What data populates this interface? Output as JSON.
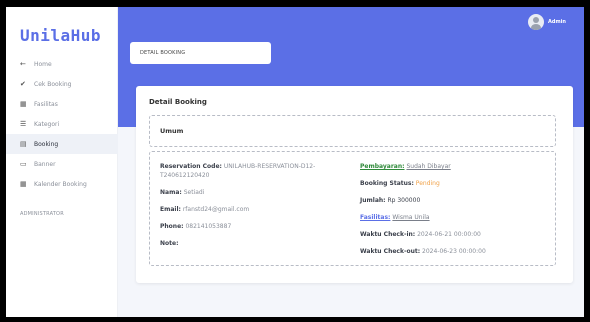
{
  "brand": "UnilaHub",
  "sidebar": {
    "items": [
      {
        "label": "Home",
        "icon": "arrow-left-icon",
        "glyph": "←",
        "active": false
      },
      {
        "label": "Cek Booking",
        "icon": "check-icon",
        "glyph": "✔",
        "active": false
      },
      {
        "label": "Fasilitas",
        "icon": "building-icon",
        "glyph": "▦",
        "active": false
      },
      {
        "label": "Kategori",
        "icon": "list-icon",
        "glyph": "☰",
        "active": false
      },
      {
        "label": "Booking",
        "icon": "book-icon",
        "glyph": "▤",
        "active": true
      },
      {
        "label": "Banner",
        "icon": "image-icon",
        "glyph": "▭",
        "active": false
      },
      {
        "label": "Kalender Booking",
        "icon": "calendar-icon",
        "glyph": "▦",
        "active": false
      }
    ],
    "section_label": "ADMINISTRATOR"
  },
  "header": {
    "user_label": "Admin",
    "breadcrumb": "DETAIL BOOKING",
    "accent_color": "#5b6fe6"
  },
  "card": {
    "title": "Detail Booking",
    "section_title": "Umum",
    "left": {
      "reservation_label": "Reservation Code:",
      "reservation_value": "UNILAHUB-RESERVATION-D12-T240612120420",
      "nama_label": "Nama:",
      "nama_value": "Setiadi",
      "email_label": "Email:",
      "email_value": "rfanstd24@gmail.com",
      "phone_label": "Phone:",
      "phone_value": "082141053887",
      "note_label": "Note:",
      "note_value": ""
    },
    "right": {
      "pembayaran_label": "Pembayaran:",
      "pembayaran_value": "Sudah Dibayar",
      "status_label": "Booking Status:",
      "status_value": "Pending",
      "jumlah_label": "Jumlah:",
      "jumlah_value": "Rp 300000",
      "fasilitas_label": "Fasilitas:",
      "fasilitas_value": "Wisma Unila",
      "checkin_label": "Waktu Check-in:",
      "checkin_value": "2024-06-21 00:00:00",
      "checkout_label": "Waktu Check-out:",
      "checkout_value": "2024-06-23 00:00:00"
    }
  }
}
